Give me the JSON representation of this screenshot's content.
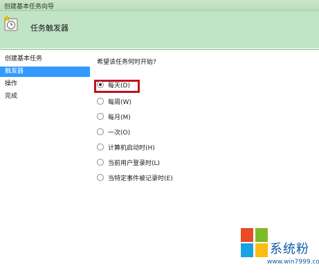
{
  "window": {
    "title": "创建基本任务向导"
  },
  "header": {
    "title": "任务触发器",
    "icon": "clock-star-icon"
  },
  "sidebar": {
    "items": [
      {
        "label": "创建基本任务",
        "active": false
      },
      {
        "label": "触发器",
        "active": true
      },
      {
        "label": "操作",
        "active": false
      },
      {
        "label": "完成",
        "active": false
      }
    ]
  },
  "main": {
    "question": "希望该任务何时开始?",
    "options": [
      {
        "label": "每天(D)",
        "checked": true
      },
      {
        "label": "每周(W)",
        "checked": false
      },
      {
        "label": "每月(M)",
        "checked": false
      },
      {
        "label": "一次(O)",
        "checked": false
      },
      {
        "label": "计算机启动时(H)",
        "checked": false
      },
      {
        "label": "当前用户登录时(L)",
        "checked": false
      },
      {
        "label": "当特定事件被记录时(E)",
        "checked": false
      }
    ]
  },
  "watermark": {
    "brand_text": "系统粉",
    "url_text": "www.win7999.com",
    "colors": {
      "red": "#e94b24",
      "green": "#7cbb2a",
      "blue": "#1aa1e1",
      "yellow": "#fbbd14"
    }
  },
  "colors": {
    "accent": "#3399ff",
    "header_bg": "#c2e4c6",
    "highlight": "#c0121c"
  }
}
